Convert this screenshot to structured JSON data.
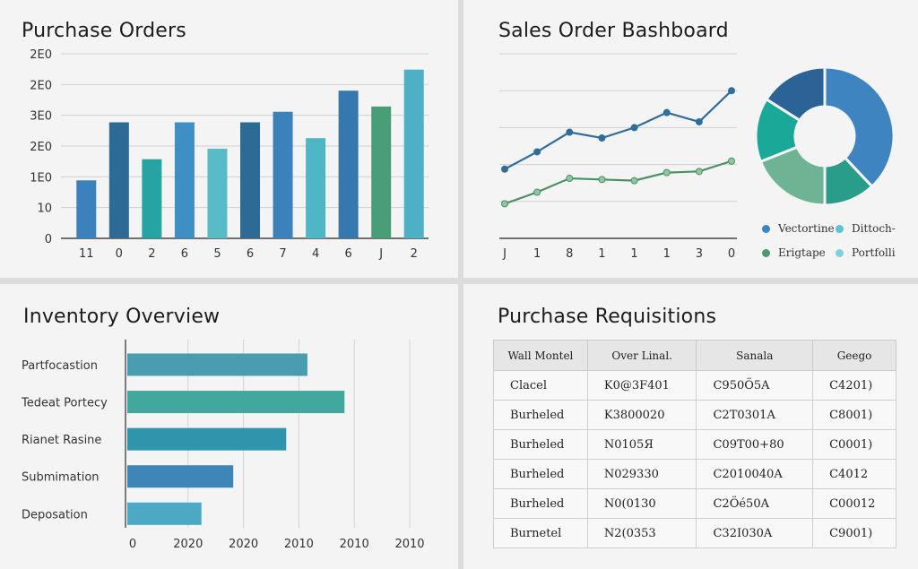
{
  "purchase_orders": {
    "title": "Purchase Orders",
    "ytick_labels": [
      "2E0",
      "2E0",
      "3E0",
      "2E0",
      "1E0",
      "10",
      "0"
    ],
    "xtick_labels": [
      "11",
      "0",
      "2",
      "6",
      "5",
      "6",
      "7",
      "4",
      "6",
      "J",
      "2"
    ]
  },
  "sales_order": {
    "title": "Sales Order Bashboard",
    "xtick_labels": [
      "J",
      "1",
      "8",
      "1",
      "1",
      "1",
      "3",
      "0"
    ],
    "legend": [
      {
        "label": "Vectortine",
        "color": "#3d84c0"
      },
      {
        "label": "Dittoch-",
        "color": "#5fc2d0"
      },
      {
        "label": "Erigtape",
        "color": "#4a9a6e"
      },
      {
        "label": "Portfolli",
        "color": "#7fd0dc"
      }
    ]
  },
  "inventory": {
    "title": "Inventory Overview",
    "categories": [
      "Partfocastion",
      "Tedeat Portecy",
      "Rianet Rasine",
      "Submimation",
      "Deposation"
    ],
    "xtick_labels": [
      "0",
      "2020",
      "2020",
      "2010",
      "2010",
      "2010"
    ]
  },
  "requisitions": {
    "title": "Purchase Requisitions",
    "headers": [
      "Wall Montel",
      "Over Linal.",
      "Sanala",
      "Geego"
    ],
    "rows": [
      [
        "Clacel",
        "K0@3F401",
        "C950Ö5A",
        "C4201)"
      ],
      [
        "Burheled",
        "K3800020",
        "C2T0301A",
        "C8001)"
      ],
      [
        "Burheled",
        "N0105Я",
        "C09T00+80",
        "C0001)"
      ],
      [
        "Burheled",
        "N029330",
        "C2010040A",
        "C4012"
      ],
      [
        "Burheled",
        "N0(0130",
        "C2Öé50A",
        "C00012"
      ],
      [
        "Burnetel",
        "N2(0353",
        "C32I030A",
        "C9001)"
      ]
    ]
  },
  "chart_data": [
    {
      "type": "bar",
      "title": "Purchase Orders",
      "categories": [
        "11",
        "0",
        "2",
        "6",
        "5",
        "6",
        "7",
        "4",
        "6",
        "J",
        "2"
      ],
      "values": [
        1.1,
        2.2,
        1.5,
        2.2,
        1.7,
        2.2,
        2.4,
        1.9,
        2.8,
        2.5,
        3.2
      ],
      "colors": [
        "#3b82bd",
        "#2e6a96",
        "#27a3a3",
        "#3f8fc4",
        "#57bcc6",
        "#2e6a96",
        "#3b82bd",
        "#4fb6c6",
        "#3578ad",
        "#4a9e77",
        "#4db0c4"
      ],
      "ylim": [
        0,
        3.5
      ],
      "grid": true
    },
    {
      "type": "line",
      "title": "Sales Order Bashboard",
      "x": [
        "J",
        "1",
        "8",
        "1",
        "1",
        "1",
        "3",
        "0"
      ],
      "series": [
        {
          "values": [
            3.0,
            3.75,
            4.6,
            4.35,
            4.8,
            5.45,
            5.05,
            6.4
          ],
          "color": "#2f6d9a"
        },
        {
          "values": [
            1.5,
            2.0,
            2.6,
            2.55,
            2.5,
            2.85,
            2.9,
            3.35
          ],
          "color": "#4a8f66"
        }
      ],
      "ylim": [
        0,
        8
      ],
      "grid": true
    },
    {
      "type": "pie",
      "donut": true,
      "slices": [
        {
          "value": 38,
          "color": "#3d84c0"
        },
        {
          "value": 12,
          "color": "#2a9c8a"
        },
        {
          "value": 19,
          "color": "#6db394"
        },
        {
          "value": 15,
          "color": "#1aa898"
        },
        {
          "value": 16,
          "color": "#2c6396"
        }
      ]
    },
    {
      "type": "bar",
      "orientation": "horizontal",
      "title": "Inventory Overview",
      "categories": [
        "Partfocastion",
        "Tedeat Portecy",
        "Rianet Rasine",
        "Submimation",
        "Deposation"
      ],
      "values": [
        68,
        82,
        60,
        40,
        28
      ],
      "colors": [
        "#4a9db0",
        "#42a89e",
        "#2f95ad",
        "#3f86b8",
        "#4ba9c4"
      ],
      "xlim": [
        0,
        110
      ],
      "grid": true
    }
  ]
}
